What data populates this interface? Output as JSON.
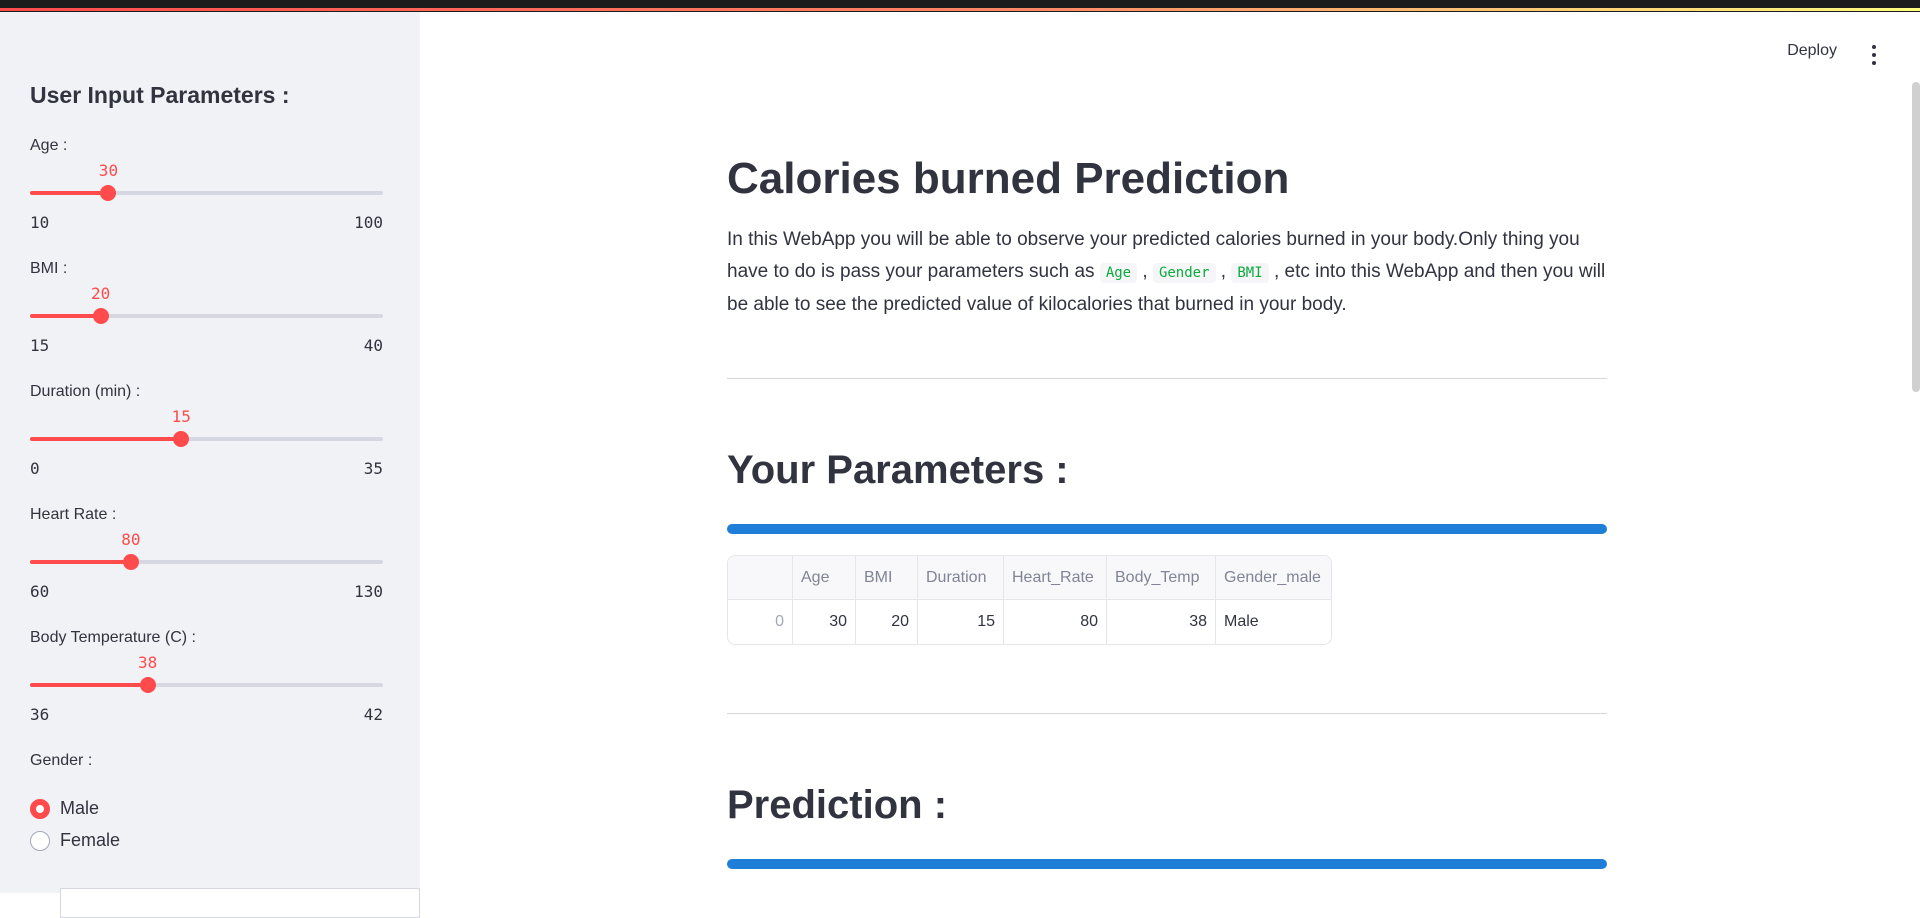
{
  "sidebar": {
    "title": "User Input Parameters :",
    "sliders": [
      {
        "label": "Age :",
        "value": 30,
        "min": 10,
        "max": 100
      },
      {
        "label": "BMI :",
        "value": 20,
        "min": 15,
        "max": 40
      },
      {
        "label": "Duration (min) :",
        "value": 15,
        "min": 0,
        "max": 35
      },
      {
        "label": "Heart Rate :",
        "value": 80,
        "min": 60,
        "max": 130
      },
      {
        "label": "Body Temperature (C) :",
        "value": 38,
        "min": 36,
        "max": 42
      }
    ],
    "gender": {
      "label": "Gender :",
      "options": [
        "Male",
        "Female"
      ],
      "selected": "Male"
    }
  },
  "header": {
    "deploy_label": "Deploy",
    "menu_icon": "kebab-vertical-icon"
  },
  "main": {
    "title": "Calories burned Prediction",
    "description": {
      "part1": "In this WebApp you will be able to observe your predicted calories burned in your body.Only thing you have to do is pass your parameters such as ",
      "code1": "Age",
      "sep1": " , ",
      "code2": "Gender",
      "sep2": " , ",
      "code3": "BMI",
      "part2": " , etc into this WebApp and then you will be able to see the predicted value of kilocalories that burned in your body."
    },
    "params_heading": "Your Parameters :",
    "table": {
      "columns": [
        "",
        "Age",
        "BMI",
        "Duration",
        "Heart_Rate",
        "Body_Temp",
        "Gender_male"
      ],
      "rows": [
        [
          "0",
          "30",
          "20",
          "15",
          "80",
          "38",
          "Male"
        ]
      ]
    },
    "prediction_heading": "Prediction :"
  },
  "colors": {
    "accent": "#ff4b4b",
    "progress": "#1f7fd8",
    "sidebar_bg": "#f0f2f6",
    "code": "#09ab3b"
  }
}
